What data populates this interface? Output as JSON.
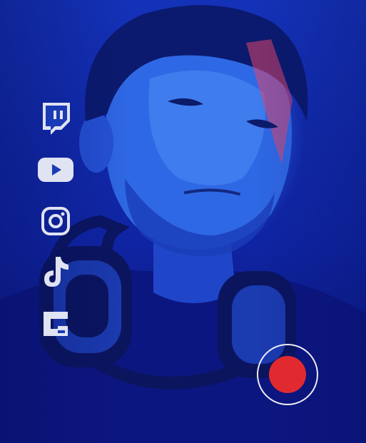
{
  "colors": {
    "background": "#1432b8",
    "icon": "#dfe3f2",
    "record_ring": "#ffffff",
    "record_dot": "#e12a2f"
  },
  "social_links": [
    {
      "icon": "twitch-icon"
    },
    {
      "icon": "youtube-icon"
    },
    {
      "icon": "instagram-icon"
    },
    {
      "icon": "tiktok-icon"
    },
    {
      "icon": "gamejolt-icon"
    }
  ],
  "record_button": {
    "icon": "record-icon"
  }
}
